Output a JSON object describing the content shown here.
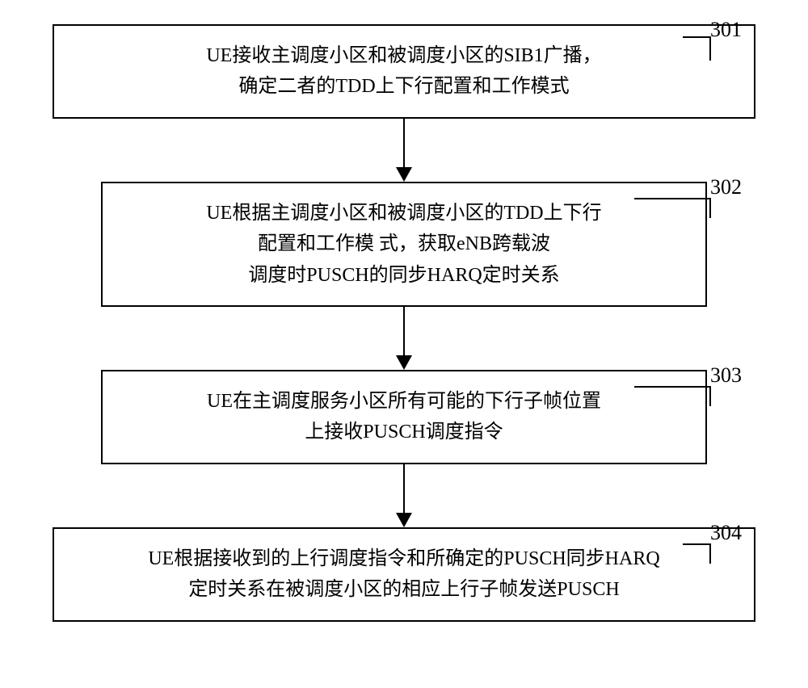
{
  "chart_data": {
    "type": "flowchart",
    "direction": "vertical",
    "steps": [
      {
        "id": "301",
        "text": "UE接收主调度小区和被调度小区的SIB1广播，\n确定二者的TDD上下行配置和工作模式"
      },
      {
        "id": "302",
        "text": "UE根据主调度小区和被调度小区的TDD上下行\n配置和工作模 式，获取eNB跨载波\n调度时PUSCH的同步HARQ定时关系"
      },
      {
        "id": "303",
        "text": "UE在主调度服务小区所有可能的下行子帧位置\n上接收PUSCH调度指令"
      },
      {
        "id": "304",
        "text": "UE根据接收到的上行调度指令和所确定的PUSCH同步HARQ\n定时关系在被调度小区的相应上行子帧发送PUSCH"
      }
    ]
  }
}
